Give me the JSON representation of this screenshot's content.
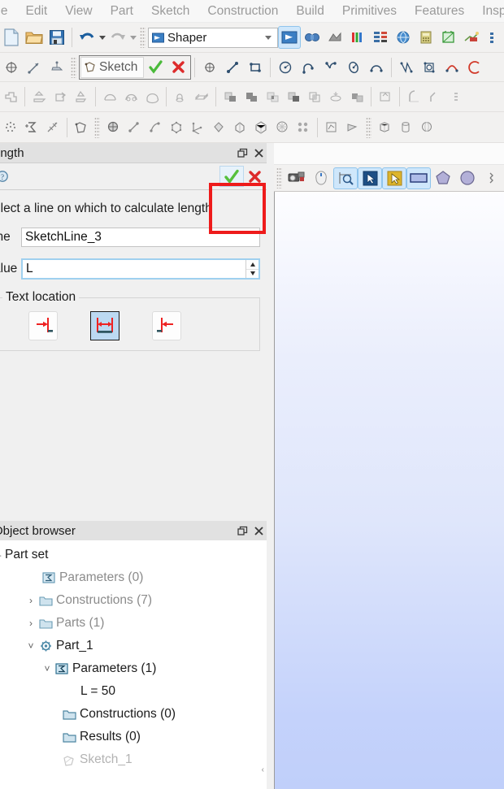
{
  "menubar": {
    "items": [
      {
        "label": "ile"
      },
      {
        "label": "Edit"
      },
      {
        "label": "View"
      },
      {
        "label": "Part"
      },
      {
        "label": "Sketch"
      },
      {
        "label": "Construction"
      },
      {
        "label": "Build"
      },
      {
        "label": "Primitives"
      },
      {
        "label": "Features"
      },
      {
        "label": "Insp"
      }
    ]
  },
  "toolbar_main": {
    "module_combo": {
      "value": "Shaper",
      "icon": "shaper-module-icon"
    },
    "icons": [
      {
        "name": "new-document-icon"
      },
      {
        "name": "open-folder-icon"
      },
      {
        "name": "save-document-icon"
      },
      {
        "name": "undo-icon"
      },
      {
        "name": "undo-dropdown-icon"
      },
      {
        "name": "redo-icon"
      },
      {
        "name": "redo-dropdown-icon"
      }
    ],
    "module_icons": [
      {
        "name": "shaper-module-icon"
      },
      {
        "name": "geometry-module-icon"
      },
      {
        "name": "mesh-module-icon"
      },
      {
        "name": "fields-module-icon"
      },
      {
        "name": "table-module-icon"
      },
      {
        "name": "paravis-module-icon"
      },
      {
        "name": "calculator-module-icon"
      },
      {
        "name": "shapes-module-icon"
      },
      {
        "name": "homard-module-icon"
      },
      {
        "name": "extra-module-icon"
      }
    ]
  },
  "toolbar_sketch": {
    "sketch_button_label": "Sketch",
    "accept_icon": "green-check-icon",
    "cancel_icon": "red-cross-icon",
    "tools": [
      {
        "name": "sketch-point-icon"
      },
      {
        "name": "sketch-line-icon"
      },
      {
        "name": "sketch-rectangle-icon"
      },
      {
        "name": "sketch-circle-icon"
      },
      {
        "name": "sketch-arc-icon"
      },
      {
        "name": "sketch-arc-3pt-icon"
      },
      {
        "name": "sketch-ellipse-icon"
      },
      {
        "name": "sketch-elliptic-arc-icon"
      },
      {
        "name": "sketch-bspline-icon"
      },
      {
        "name": "sketch-bspline-periodic-icon"
      },
      {
        "name": "sketch-interpolation-icon"
      },
      {
        "name": "sketch-projection-icon"
      }
    ]
  },
  "toolbar_features": {
    "icons": [
      {
        "name": "feature-shape-icon"
      },
      {
        "name": "extrusion-icon"
      },
      {
        "name": "extrusion-cut-icon"
      },
      {
        "name": "extrusion-fuse-icon"
      },
      {
        "name": "revolution-icon"
      },
      {
        "name": "revolution-cut-icon"
      },
      {
        "name": "revolution-fuse-icon"
      },
      {
        "name": "pipe-icon"
      },
      {
        "name": "loft-icon"
      },
      {
        "name": "boolean-cut-icon"
      },
      {
        "name": "boolean-fuse-icon"
      },
      {
        "name": "boolean-common-icon"
      },
      {
        "name": "boolean-smash-icon"
      },
      {
        "name": "boolean-split-icon"
      },
      {
        "name": "boolean-fill-icon"
      },
      {
        "name": "partition-icon"
      },
      {
        "name": "recover-icon"
      },
      {
        "name": "fillet-icon"
      },
      {
        "name": "chamfer-icon"
      }
    ]
  },
  "toolbar_construction": {
    "icons": [
      {
        "name": "group-points-icon"
      },
      {
        "name": "field-sum-icon"
      },
      {
        "name": "measurement-icon"
      },
      {
        "name": "sketch-face-icon"
      },
      {
        "name": "construction-point-icon"
      },
      {
        "name": "construction-axis-icon"
      },
      {
        "name": "construction-curve-icon"
      },
      {
        "name": "construction-polyline-icon"
      },
      {
        "name": "construction-vertex-icon"
      },
      {
        "name": "construction-face-icon"
      },
      {
        "name": "construction-shell-icon"
      },
      {
        "name": "construction-solid-icon"
      },
      {
        "name": "construction-compsolid-icon"
      },
      {
        "name": "construction-compound-icon"
      },
      {
        "name": "construction-plane-icon"
      },
      {
        "name": "construction-filling-icon"
      },
      {
        "name": "primitive-box-icon"
      },
      {
        "name": "primitive-cylinder-icon"
      },
      {
        "name": "primitive-sphere-icon"
      }
    ]
  },
  "property_panel": {
    "dock_title": "ength",
    "restore_icon": "restore-window-icon",
    "close_icon": "close-panel-icon",
    "help_icon": "help-icon",
    "ok_icon": "green-check-icon",
    "cancel_icon": "red-cross-icon",
    "hint": "elect a line on which to calculate length",
    "fields": [
      {
        "label": "ine",
        "value": "SketchLine_3",
        "name": "line-field"
      },
      {
        "label": "alue",
        "value": "L",
        "name": "value-field"
      }
    ],
    "group": {
      "title": "Text location",
      "buttons": [
        {
          "name": "text-location-left-button",
          "selected": false
        },
        {
          "name": "text-location-center-button",
          "selected": true
        },
        {
          "name": "text-location-right-button",
          "selected": false
        }
      ]
    },
    "highlight_color": "#ee1b1b"
  },
  "object_browser": {
    "dock_title": "Object browser",
    "restore_icon": "restore-window-icon",
    "close_icon": "close-panel-icon",
    "tree": [
      {
        "label": "Part set",
        "indent": 0,
        "twisty": "collapsed-dash",
        "icon": "",
        "tone": "dark"
      },
      {
        "label": "Parameters (0)",
        "indent": 2,
        "twisty": "",
        "icon": "parameters-icon",
        "tone": "gray"
      },
      {
        "label": "Constructions (7)",
        "indent": 1,
        "twisty": "right",
        "icon": "folder-icon",
        "tone": "gray"
      },
      {
        "label": "Parts (1)",
        "indent": 1,
        "twisty": "right",
        "icon": "folder-icon",
        "tone": "gray"
      },
      {
        "label": "Part_1",
        "indent": 1,
        "twisty": "down",
        "icon": "part-gear-icon",
        "tone": "dark"
      },
      {
        "label": "Parameters (1)",
        "indent": 2,
        "twisty": "down",
        "icon": "parameters-icon",
        "tone": "dark"
      },
      {
        "label": "L = 50",
        "indent": 4,
        "twisty": "",
        "icon": "",
        "tone": "dark"
      },
      {
        "label": "Constructions (0)",
        "indent": 3,
        "twisty": "",
        "icon": "folder-icon",
        "tone": "dark"
      },
      {
        "label": "Results (0)",
        "indent": 3,
        "twisty": "",
        "icon": "folder-icon",
        "tone": "dark"
      },
      {
        "label": "Sketch_1",
        "indent": 3,
        "twisty": "",
        "icon": "sketch-faded-icon",
        "tone": "faded"
      }
    ]
  },
  "viewport": {
    "toolbar_icons": [
      {
        "name": "dump-view-icon",
        "active": false
      },
      {
        "name": "mouse-style-icon",
        "active": false
      },
      {
        "name": "fit-all-icon",
        "active": true
      },
      {
        "name": "selection-neutral-icon",
        "active": true
      },
      {
        "name": "selection-highlight-icon",
        "active": true
      },
      {
        "name": "select-face-icon",
        "active": true
      },
      {
        "name": "select-shell-icon",
        "active": false
      },
      {
        "name": "select-solid-icon",
        "active": false
      }
    ],
    "background_top": "#fdfdff",
    "background_bottom": "#c0cffa"
  }
}
